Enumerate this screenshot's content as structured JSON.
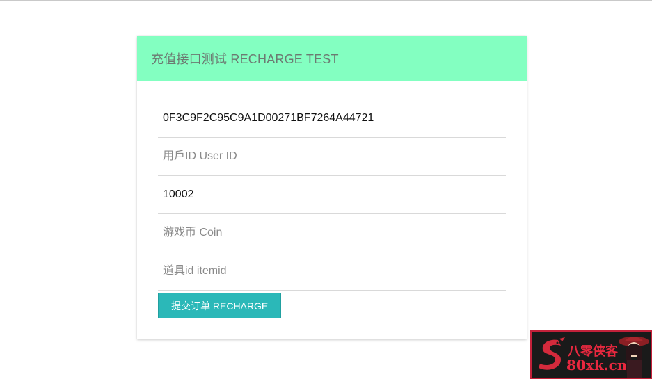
{
  "header": {
    "title": "充值接口测试 RECHARGE TEST"
  },
  "form": {
    "fields": [
      {
        "value": "0F3C9F2C95C9A1D00271BF7264A44721",
        "placeholder": ""
      },
      {
        "value": "",
        "placeholder": "用戶ID User ID"
      },
      {
        "value": "10002",
        "placeholder": ""
      },
      {
        "value": "",
        "placeholder": "游戏币 Coin"
      },
      {
        "value": "",
        "placeholder": "道具id itemid"
      }
    ],
    "submit_label": "提交订单 RECHARGE"
  },
  "watermark": {
    "line1": "八零侠客",
    "line2": "80xk.cn"
  },
  "colors": {
    "header_bg": "#83ffc1",
    "button_bg": "#2bb8b8",
    "watermark_red": "#e8283f"
  }
}
